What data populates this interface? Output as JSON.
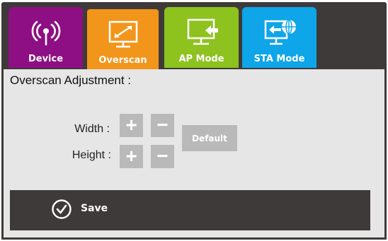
{
  "tabs": [
    {
      "label": "Device",
      "icon": "wireless-signal-icon",
      "color": "#8e0f83"
    },
    {
      "label": "Overscan",
      "icon": "resize-screen-icon",
      "color": "#f2951b",
      "active": true
    },
    {
      "label": "AP Mode",
      "icon": "monitor-arrow-icon",
      "color": "#8dc21f"
    },
    {
      "label": "STA Mode",
      "icon": "screen-globe-icon",
      "color": "#0ea5e9"
    }
  ],
  "panel": {
    "title": "Overscan Adjustment :",
    "width_label": "Width :",
    "height_label": "Height :",
    "plus": "+",
    "minus": "−",
    "default_label": "Default"
  },
  "save": {
    "label": "Save",
    "icon": "check-circle-icon"
  }
}
